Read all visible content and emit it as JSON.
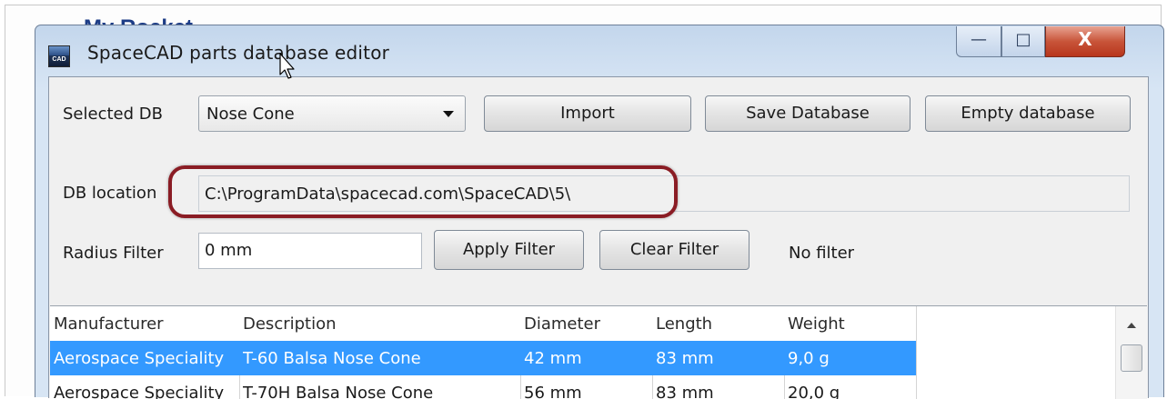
{
  "background": {
    "partial_title": "My Rocket"
  },
  "window": {
    "title": "SpaceCAD parts database editor",
    "icon_text": "CAD",
    "controls": {
      "minimize": "—",
      "maximize": "□",
      "close": "X"
    }
  },
  "form": {
    "selected_db_label": "Selected DB",
    "selected_db_value": "Nose Cone",
    "import_label": "Import",
    "save_label": "Save Database",
    "empty_label": "Empty database",
    "location_label": "DB location",
    "location_value": "C:\\ProgramData\\spacecad.com\\SpaceCAD\\5\\",
    "radius_label": "Radius Filter",
    "radius_value": "0 mm",
    "apply_label": "Apply Filter",
    "clear_label": "Clear Filter",
    "filter_status": "No filter"
  },
  "table": {
    "columns": [
      "Manufacturer",
      "Description",
      "Diameter",
      "Length",
      "Weight"
    ],
    "rows": [
      [
        "Aerospace Speciality",
        "T-60 Balsa Nose Cone",
        "42 mm",
        "83 mm",
        "9,0 g"
      ],
      [
        "Aerospace Speciality",
        "T-70H Balsa Nose Cone",
        "56 mm",
        "83 mm",
        "20,0 g"
      ]
    ],
    "selected_row": 0
  },
  "colors": {
    "selection": "#3399ff",
    "highlight_ring": "#8a1c24",
    "close_button": "#c8553a"
  }
}
